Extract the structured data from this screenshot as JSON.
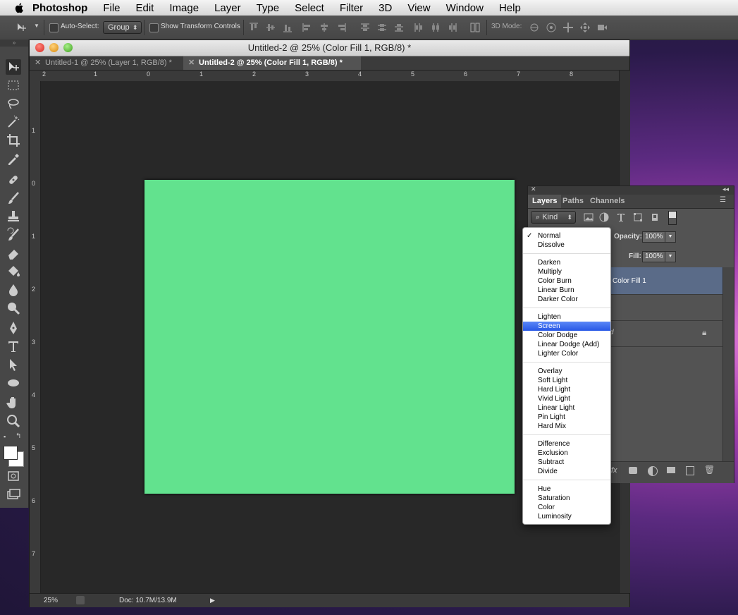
{
  "menubar": {
    "app": "Photoshop",
    "items": [
      "File",
      "Edit",
      "Image",
      "Layer",
      "Type",
      "Select",
      "Filter",
      "3D",
      "View",
      "Window",
      "Help"
    ]
  },
  "options": {
    "auto_select_label": "Auto-Select:",
    "auto_select_value": "Group",
    "show_transform_label": "Show Transform Controls",
    "mode_label": "3D Mode:"
  },
  "document": {
    "title": "Untitled-2 @ 25% (Color Fill 1, RGB/8) *",
    "tabs": [
      {
        "label": "Untitled-1 @ 25% (Layer 1, RGB/8) *",
        "active": false
      },
      {
        "label": "Untitled-2 @ 25% (Color Fill 1, RGB/8) *",
        "active": true
      }
    ],
    "ruler_h": [
      "2",
      "1",
      "0",
      "1",
      "2",
      "3",
      "4",
      "5",
      "6",
      "7",
      "8"
    ],
    "ruler_v": [
      "1",
      "0",
      "1",
      "2",
      "3",
      "4",
      "5",
      "6",
      "7"
    ],
    "canvas_color": "#62e28e",
    "zoom": "25%",
    "doc_info": "Doc: 10.7M/13.9M"
  },
  "layers_panel": {
    "tabs": [
      "Layers",
      "Paths",
      "Channels"
    ],
    "kind_label": "Kind",
    "opacity_label": "Opacity:",
    "opacity_value": "100%",
    "fill_label": "Fill:",
    "fill_value": "100%",
    "layer_name": "Color Fill 1",
    "background_partial": "d"
  },
  "blend_menu": {
    "checked": "Normal",
    "selected": "Screen",
    "groups": [
      [
        "Normal",
        "Dissolve"
      ],
      [
        "Darken",
        "Multiply",
        "Color Burn",
        "Linear Burn",
        "Darker Color"
      ],
      [
        "Lighten",
        "Screen",
        "Color Dodge",
        "Linear Dodge (Add)",
        "Lighter Color"
      ],
      [
        "Overlay",
        "Soft Light",
        "Hard Light",
        "Vivid Light",
        "Linear Light",
        "Pin Light",
        "Hard Mix"
      ],
      [
        "Difference",
        "Exclusion",
        "Subtract",
        "Divide"
      ],
      [
        "Hue",
        "Saturation",
        "Color",
        "Luminosity"
      ]
    ]
  },
  "colors": {
    "accent": "#2757e6",
    "layer_selected": "#5a6b88"
  }
}
